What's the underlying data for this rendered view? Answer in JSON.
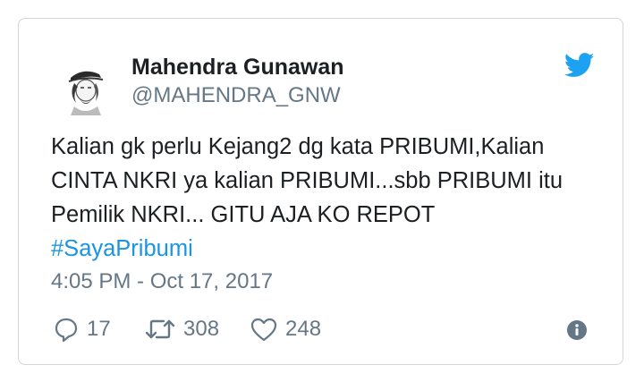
{
  "tweet": {
    "author_name": "Mahendra Gunawan",
    "author_handle": "@MAHENDRA_GNW",
    "text_lines": [
      "Kalian gk perlu Kejang2 dg kata PRIBUMI,Kalian",
      "CINTA NKRI ya kalian PRIBUMI...sbb PRIBUMI itu",
      "Pemilik NKRI... GITU AJA KO REPOT"
    ],
    "hashtag": "#SayaPribumi",
    "timestamp": "4:05 PM - Oct 17, 2017",
    "replies": "17",
    "retweets": "308",
    "likes": "248"
  },
  "icons": {
    "brand": "twitter-bird-icon",
    "reply": "reply-icon",
    "retweet": "retweet-icon",
    "like": "heart-icon",
    "info": "info-icon"
  },
  "colors": {
    "twitter_blue": "#1da1f2",
    "hashtag_blue": "#1b95e0",
    "muted_text": "#657786",
    "border": "#cfd6dc"
  }
}
